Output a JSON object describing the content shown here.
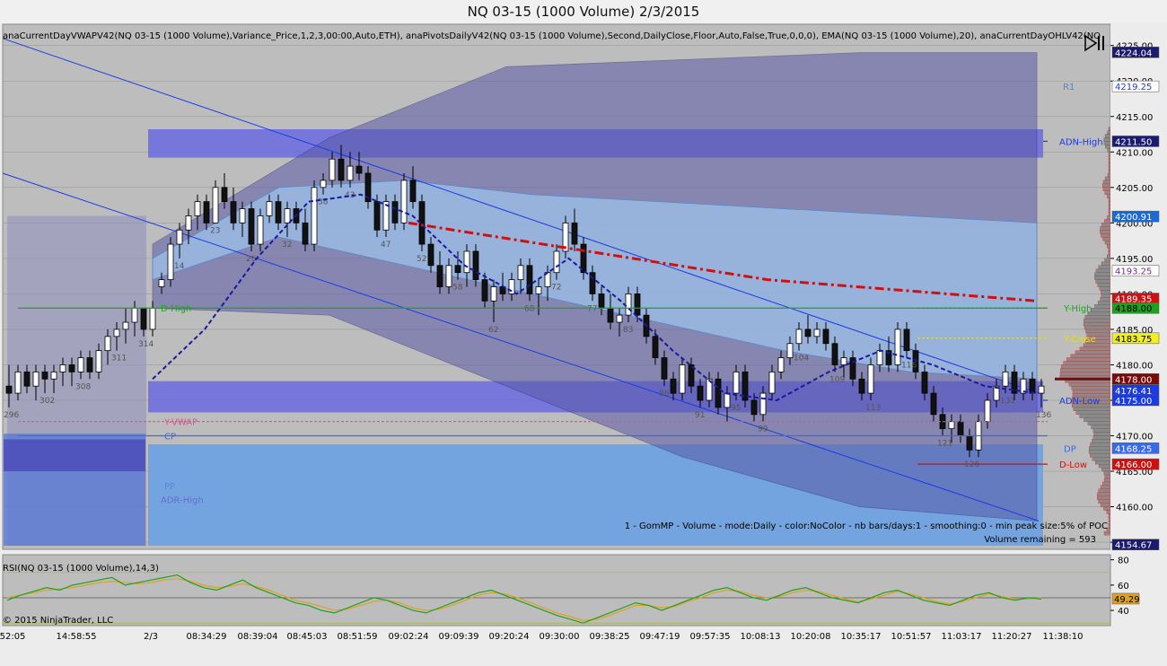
{
  "window": {
    "title": "NQ 03-15 (1000 Volume)  2/3/2015"
  },
  "indicator_header": "anaCurrentDayVWAPV42(NQ 03-15 (1000 Volume),Variance_Price,1,2,3,00:00,Auto,ETH), anaPivotsDailyV42(NQ 03-15 (1000 Volume),Second,DailyClose,Floor,Auto,False,True,0,0,0), EMA(NQ 03-15 (1000 Volume),20), anaCurrentDayOHLV42(NQ",
  "copyright": "© 2015 NinjaTrader, LLC",
  "rsi_label": "RSI(NQ 03-15 (1000 Volume),14,3)",
  "profile_note": "1 - GomMP - Volume - mode:Daily  - color:NoColor - nb bars/days:1 - smoothing:0 - min peak size:5% of POC",
  "volume_remaining": "Volume remaining = 593",
  "colors": {
    "panel_bg": "#bdbdbd",
    "up_candle": "#ffffff",
    "down_candle": "#111111",
    "vwap": "#1a1a9e",
    "ema": "#d01010",
    "band_outer": "#5a5aa8",
    "band_inner": "#9ec3ea",
    "zone": "#6a6ae0",
    "profile": "#d42020"
  },
  "chart_data": [
    {
      "type": "candlestick",
      "title": "NQ 03-15 (1000 Volume)  2/3/2015",
      "ylim": [
        4154,
        4228
      ],
      "y_ticks": [
        "4225.00",
        "4220.00",
        "4215.00",
        "4210.00",
        "4205.00",
        "4200.00",
        "4195.00",
        "4190.00",
        "4185.00",
        "4180.00",
        "4175.00",
        "4170.00",
        "4165.00",
        "4160.00",
        "4155.00"
      ],
      "x_tick_labels": [
        "52:05",
        "14:58:55",
        "2/3",
        "08:34:29",
        "08:39:04",
        "08:45:03",
        "08:51:59",
        "09:02:24",
        "09:09:39",
        "09:20:24",
        "09:30:00",
        "09:38:25",
        "09:47:19",
        "09:57:35",
        "10:08:13",
        "10:20:08",
        "10:35:17",
        "10:51:57",
        "11:03:17",
        "11:20:27",
        "11:38:10"
      ],
      "ohlc": [
        [
          4177,
          4180,
          4174,
          4176
        ],
        [
          4176,
          4180,
          4175,
          4179
        ],
        [
          4179,
          4180,
          4176,
          4177
        ],
        [
          4177,
          4180,
          4175,
          4179
        ],
        [
          4179,
          4180,
          4176,
          4178
        ],
        [
          4178,
          4180,
          4176,
          4179
        ],
        [
          4179,
          4181,
          4177,
          4180
        ],
        [
          4180,
          4181,
          4177,
          4179
        ],
        [
          4179,
          4182,
          4178,
          4181
        ],
        [
          4181,
          4182,
          4178,
          4179
        ],
        [
          4179,
          4183,
          4178,
          4182
        ],
        [
          4182,
          4185,
          4180,
          4184
        ],
        [
          4184,
          4186,
          4182,
          4185
        ],
        [
          4185,
          4188,
          4183,
          4186
        ],
        [
          4186,
          4189,
          4184,
          4188
        ],
        [
          4188,
          4188,
          4184,
          4185
        ],
        [
          4185,
          4189,
          4184,
          4188
        ],
        [
          4191,
          4193,
          4190,
          4192
        ],
        [
          4192,
          4198,
          4191,
          4197
        ],
        [
          4197,
          4200,
          4195,
          4199
        ],
        [
          4199,
          4202,
          4197,
          4201
        ],
        [
          4201,
          4204,
          4199,
          4203
        ],
        [
          4203,
          4204,
          4199,
          4200
        ],
        [
          4200,
          4206,
          4200,
          4205
        ],
        [
          4205,
          4207,
          4202,
          4203
        ],
        [
          4203,
          4205,
          4199,
          4200
        ],
        [
          4200,
          4203,
          4198,
          4202
        ],
        [
          4202,
          4203,
          4196,
          4197
        ],
        [
          4197,
          4202,
          4196,
          4201
        ],
        [
          4201,
          4204,
          4200,
          4203
        ],
        [
          4203,
          4204,
          4199,
          4200
        ],
        [
          4200,
          4203,
          4198,
          4202
        ],
        [
          4202,
          4203,
          4199,
          4200
        ],
        [
          4200,
          4202,
          4196,
          4197
        ],
        [
          4197,
          4206,
          4196,
          4205
        ],
        [
          4205,
          4207,
          4204,
          4206
        ],
        [
          4206,
          4210,
          4205,
          4209
        ],
        [
          4209,
          4211,
          4205,
          4206
        ],
        [
          4206,
          4210,
          4205,
          4208
        ],
        [
          4208,
          4210,
          4206,
          4207
        ],
        [
          4207,
          4208,
          4202,
          4203
        ],
        [
          4203,
          4204,
          4198,
          4199
        ],
        [
          4199,
          4204,
          4198,
          4203
        ],
        [
          4203,
          4204,
          4199,
          4200
        ],
        [
          4200,
          4207,
          4199,
          4206
        ],
        [
          4206,
          4208,
          4202,
          4203
        ],
        [
          4203,
          4204,
          4196,
          4197
        ],
        [
          4197,
          4198,
          4193,
          4194
        ],
        [
          4194,
          4196,
          4190,
          4191
        ],
        [
          4191,
          4195,
          4190,
          4194
        ],
        [
          4194,
          4196,
          4192,
          4193
        ],
        [
          4193,
          4197,
          4191,
          4196
        ],
        [
          4196,
          4197,
          4191,
          4192
        ],
        [
          4192,
          4193,
          4188,
          4189
        ],
        [
          4189,
          4192,
          4186,
          4191
        ],
        [
          4191,
          4193,
          4189,
          4190
        ],
        [
          4190,
          4193,
          4189,
          4192
        ],
        [
          4192,
          4195,
          4190,
          4194
        ],
        [
          4194,
          4195,
          4189,
          4190
        ],
        [
          4190,
          4192,
          4187,
          4191
        ],
        [
          4191,
          4194,
          4189,
          4193
        ],
        [
          4193,
          4197,
          4192,
          4196
        ],
        [
          4196,
          4201,
          4195,
          4200
        ],
        [
          4200,
          4202,
          4196,
          4197
        ],
        [
          4197,
          4198,
          4192,
          4193
        ],
        [
          4193,
          4194,
          4189,
          4190
        ],
        [
          4190,
          4191,
          4187,
          4188
        ],
        [
          4188,
          4190,
          4185,
          4186
        ],
        [
          4186,
          4188,
          4184,
          4187
        ],
        [
          4187,
          4191,
          4186,
          4190
        ],
        [
          4190,
          4191,
          4186,
          4187
        ],
        [
          4187,
          4188,
          4183,
          4184
        ],
        [
          4184,
          4185,
          4180,
          4181
        ],
        [
          4181,
          4182,
          4177,
          4178
        ],
        [
          4178,
          4179,
          4175,
          4176
        ],
        [
          4176,
          4181,
          4175,
          4180
        ],
        [
          4180,
          4181,
          4176,
          4177
        ],
        [
          4177,
          4178,
          4174,
          4175
        ],
        [
          4175,
          4179,
          4174,
          4178
        ],
        [
          4178,
          4179,
          4173,
          4174
        ],
        [
          4174,
          4177,
          4172,
          4176
        ],
        [
          4176,
          4180,
          4175,
          4179
        ],
        [
          4179,
          4180,
          4174,
          4175
        ],
        [
          4175,
          4176,
          4172,
          4173
        ],
        [
          4173,
          4177,
          4172,
          4176
        ],
        [
          4176,
          4180,
          4175,
          4179
        ],
        [
          4179,
          4182,
          4178,
          4181
        ],
        [
          4181,
          4184,
          4180,
          4183
        ],
        [
          4183,
          4186,
          4182,
          4185
        ],
        [
          4185,
          4187,
          4183,
          4184
        ],
        [
          4184,
          4186,
          4183,
          4185
        ],
        [
          4185,
          4186,
          4182,
          4183
        ],
        [
          4183,
          4184,
          4179,
          4180
        ],
        [
          4180,
          4182,
          4178,
          4181
        ],
        [
          4181,
          4182,
          4177,
          4178
        ],
        [
          4178,
          4179,
          4175,
          4176
        ],
        [
          4176,
          4181,
          4175,
          4180
        ],
        [
          4180,
          4183,
          4179,
          4182
        ],
        [
          4182,
          4184,
          4179,
          4180
        ],
        [
          4180,
          4186,
          4179,
          4185
        ],
        [
          4185,
          4186,
          4181,
          4182
        ],
        [
          4182,
          4183,
          4178,
          4179
        ],
        [
          4179,
          4180,
          4175,
          4176
        ],
        [
          4176,
          4177,
          4172,
          4173
        ],
        [
          4173,
          4174,
          4170,
          4171
        ],
        [
          4171,
          4173,
          4169,
          4172
        ],
        [
          4172,
          4173,
          4169,
          4170
        ],
        [
          4170,
          4171,
          4167,
          4168
        ],
        [
          4168,
          4173,
          4167,
          4172
        ],
        [
          4172,
          4176,
          4171,
          4175
        ],
        [
          4175,
          4178,
          4174,
          4177
        ],
        [
          4177,
          4180,
          4176,
          4179
        ],
        [
          4179,
          4180,
          4175,
          4176
        ],
        [
          4176,
          4179,
          4175,
          4178
        ],
        [
          4178,
          4179,
          4175,
          4176
        ],
        [
          4176,
          4178,
          4174,
          4177
        ]
      ],
      "bar_count_labels": [
        "296",
        "302",
        "308",
        "311",
        "314",
        "14",
        "23",
        "26",
        "32",
        "38",
        "43",
        "47",
        "52",
        "58",
        "62",
        "68",
        "72",
        "77",
        "83",
        "86",
        "91",
        "95",
        "99",
        "104",
        "109",
        "113",
        "116",
        "121",
        "126",
        "131",
        "136"
      ],
      "vwap_y": [
        4178,
        4185,
        4195,
        4203,
        4204,
        4201,
        4194,
        4190,
        4195,
        4189,
        4182,
        4176,
        4175,
        4179,
        4182,
        4180,
        4177,
        4176
      ],
      "ema20_y": [
        4200,
        4198,
        4196,
        4194,
        4192,
        4191,
        4190,
        4189
      ],
      "inner_band_top_y": [
        4195,
        4205,
        4206,
        4204,
        4203,
        4202,
        4201,
        4200
      ],
      "inner_band_bot_y": [
        4192,
        4198,
        4194,
        4190,
        4186,
        4182,
        4179,
        4178
      ],
      "outer_band_top_y": [
        4197,
        4212,
        4222,
        4223,
        4224,
        4224
      ],
      "outer_band_bot_y": [
        4188,
        4187,
        4177,
        4167,
        4160,
        4158
      ],
      "profile_poc": 4178.0,
      "levels": [
        {
          "label": "ADN-High",
          "value": 4211.5,
          "color": "#1a3ae6"
        },
        {
          "label": "R1",
          "value": 4219.25,
          "color": "#4a8ad6"
        },
        {
          "label": "ADN-Low",
          "value": 4175.0,
          "color": "#1a3ae6"
        },
        {
          "label": "D-Low",
          "value": 4166.0,
          "color": "#d01010"
        },
        {
          "label": "DP",
          "value": 4168.25,
          "color": "#3a6ae6"
        },
        {
          "label": "Y-Close",
          "value": 4183.75,
          "color": "#e0e020"
        },
        {
          "label": "Y-High",
          "value": 4188.0,
          "color": "#20a020"
        },
        {
          "label": "Y-VWAP",
          "value": 4172.0,
          "color": "#e05090"
        },
        {
          "label": "CP",
          "value": 4170.0,
          "color": "#3a6ae6"
        },
        {
          "label": "PP",
          "value": 4163.0,
          "color": "#5a8ad6"
        },
        {
          "label": "ADR-High",
          "value": 4161.0,
          "color": "#6a6ad6"
        },
        {
          "label": "D-High",
          "value": 4188.0,
          "color": "#20a020"
        }
      ],
      "price_markers": [
        {
          "text": "4224.04",
          "value": 4224.04,
          "bg": "#1a1a6e",
          "fg": "#ffffff"
        },
        {
          "text": "4219.25",
          "value": 4219.25,
          "bg": "#ffffff",
          "fg": "#1a3ae6"
        },
        {
          "text": "4211.50",
          "value": 4211.5,
          "bg": "#1a1a6e",
          "fg": "#ffffff"
        },
        {
          "text": "4200.91",
          "value": 4200.91,
          "bg": "#1a6ad6",
          "fg": "#ffffff"
        },
        {
          "text": "4193.25",
          "value": 4193.25,
          "bg": "#ffffff",
          "fg": "#7a2a8a"
        },
        {
          "text": "4189.35",
          "value": 4189.35,
          "bg": "#d01010",
          "fg": "#ffffff"
        },
        {
          "text": "4188.00",
          "value": 4188.0,
          "bg": "#20a020",
          "fg": "#000000"
        },
        {
          "text": "4183.75",
          "value": 4183.75,
          "bg": "#f0f020",
          "fg": "#000000"
        },
        {
          "text": "4178.00",
          "value": 4178.0,
          "bg": "#7a0a0a",
          "fg": "#ffffff"
        },
        {
          "text": "4176.41",
          "value": 4176.41,
          "bg": "#1a3ae6",
          "fg": "#ffffff"
        },
        {
          "text": "4175.00",
          "value": 4175.0,
          "bg": "#1a3ae6",
          "fg": "#ffffff"
        },
        {
          "text": "4168.25",
          "value": 4168.25,
          "bg": "#3a6ae6",
          "fg": "#ffffff"
        },
        {
          "text": "4166.00",
          "value": 4166.0,
          "bg": "#d01010",
          "fg": "#ffffff"
        },
        {
          "text": "4154.67",
          "value": 4154.67,
          "bg": "#1a1a6e",
          "fg": "#ffffff"
        }
      ]
    },
    {
      "type": "line",
      "title": "RSI(NQ 03-15 (1000 Volume),14,3)",
      "ylim": [
        28,
        84
      ],
      "y_ticks": [
        "80",
        "60",
        "40"
      ],
      "last_value": "49.29",
      "levels": [
        70,
        50,
        30
      ],
      "rsi": [
        48,
        52,
        55,
        58,
        56,
        60,
        62,
        64,
        66,
        60,
        62,
        64,
        66,
        68,
        62,
        58,
        56,
        60,
        64,
        58,
        54,
        50,
        46,
        44,
        40,
        38,
        42,
        46,
        50,
        48,
        44,
        40,
        38,
        42,
        46,
        50,
        54,
        56,
        52,
        48,
        44,
        40,
        36,
        33,
        30,
        34,
        38,
        42,
        46,
        44,
        40,
        44,
        48,
        52,
        56,
        58,
        54,
        50,
        48,
        52,
        56,
        58,
        54,
        50,
        48,
        46,
        50,
        54,
        56,
        52,
        48,
        46,
        44,
        48,
        52,
        54,
        50,
        48,
        50,
        49
      ],
      "signal": [
        50,
        52,
        54,
        56,
        57,
        58,
        60,
        62,
        63,
        62,
        61,
        62,
        64,
        65,
        63,
        60,
        58,
        59,
        61,
        59,
        56,
        52,
        48,
        46,
        43,
        40,
        41,
        44,
        47,
        48,
        46,
        42,
        40,
        41,
        44,
        48,
        52,
        54,
        53,
        50,
        46,
        42,
        38,
        35,
        32,
        33,
        36,
        40,
        44,
        44,
        42,
        43,
        47,
        50,
        54,
        56,
        55,
        52,
        50,
        51,
        54,
        56,
        55,
        52,
        49,
        47,
        49,
        52,
        55,
        53,
        50,
        47,
        45,
        47,
        50,
        53,
        51,
        49,
        49,
        50
      ]
    }
  ]
}
